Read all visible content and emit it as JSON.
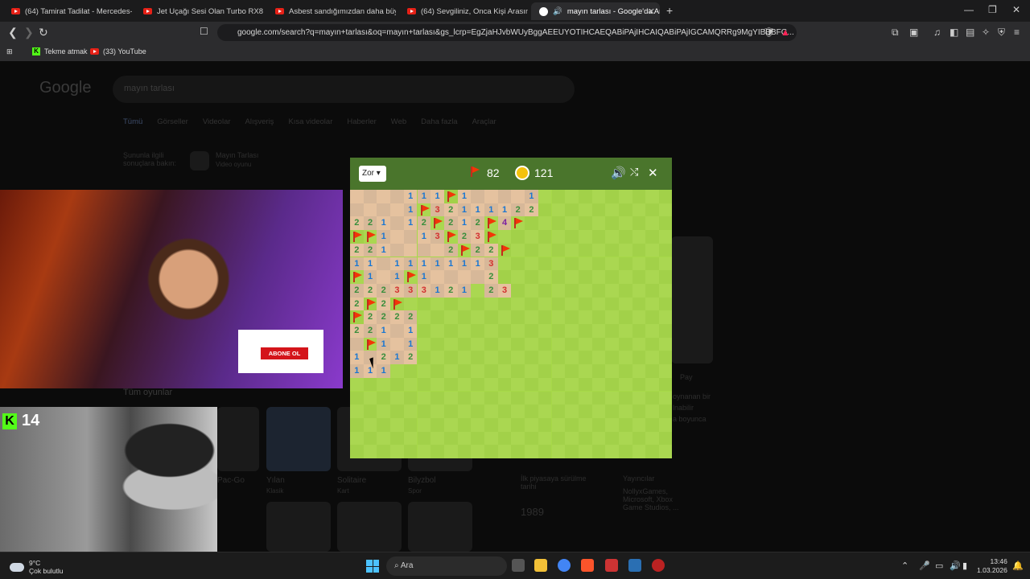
{
  "browser": {
    "tabs": [
      {
        "title": "(64) Tamirat Tadilat - Mercedes-Benz",
        "icon": "youtube-icon"
      },
      {
        "title": "Jet Uçağı Sesi Olan Turbo RX8 - YouT",
        "icon": "youtube-icon"
      },
      {
        "title": "Asbest sandığımızdan daha büyük bi",
        "icon": "youtube-icon"
      },
      {
        "title": "(64) Sevgiliniz, Onca Kişi Arasında",
        "icon": "youtube-icon"
      },
      {
        "title": "mayın tarlası - Google'da Ara",
        "icon": "google-icon",
        "active": true
      }
    ],
    "url": "google.com/search?q=mayın+tarlası&oq=mayın+tarlası&gs_lcrp=EgZjaHJvbWUyBggAEEUYOTIHCAEQABiPAjIHCAIQABiPAjIGCAMQRRg9MgYIBBBFG...",
    "bookmarks": [
      "Tekme atmak",
      "(33) YouTube"
    ]
  },
  "google": {
    "logo": "Google",
    "query": "mayın tarlası",
    "tabs": [
      "Tümü",
      "Görseller",
      "Videolar",
      "Alışveriş",
      "Kısa videolar",
      "Haberler",
      "Web",
      "Daha fazla",
      "Araçlar"
    ],
    "related_label": "Şununla ilgili sonuçlara bakın:",
    "related_item": "Mayın Tarlası",
    "related_sub": "Video oyunu",
    "all_games": "Tüm oyunlar",
    "games": [
      "Pac-Go",
      "Yılan",
      "Solitaire",
      "Bilyzbol"
    ],
    "games_sub": [
      "Klasik",
      "Kart",
      "Spor"
    ],
    "play": "Pay",
    "side_text": [
      "oynanan bir",
      "lnabilir",
      "a boyunca"
    ],
    "release_label": "İlk piyasaya sürülme tarihi",
    "release_year": "1989",
    "publishers_label": "Yayıncılar",
    "publishers": "NollyxGames, Microsoft, Xbox Game Studios, ..."
  },
  "overlay": {
    "subscribe": "ABONE OL",
    "kick_count": "14"
  },
  "game": {
    "difficulty": "Zor",
    "flags": "82",
    "time": "121",
    "colors": {
      "n1": "#1976d2",
      "n2": "#388e3c",
      "n3": "#d32f2f",
      "n4": "#7b1fa2"
    },
    "rows": [
      "....111F1....1",
      "....1F32111122",
      "221.12F212F4F",
      "FF1..13F23F",
      "221....2F22F",
      "11.11111113",
      "F1.1F1....2",
      "222333121 23",
      "2F2F",
      "F2222",
      "221.1",
      ".F1.1",
      "1.212",
      "111"
    ]
  },
  "taskbar": {
    "temp": "9°C",
    "weather": "Çok bulutlu",
    "search": "Ara",
    "time": "13:46",
    "date": "1.03.2026"
  }
}
